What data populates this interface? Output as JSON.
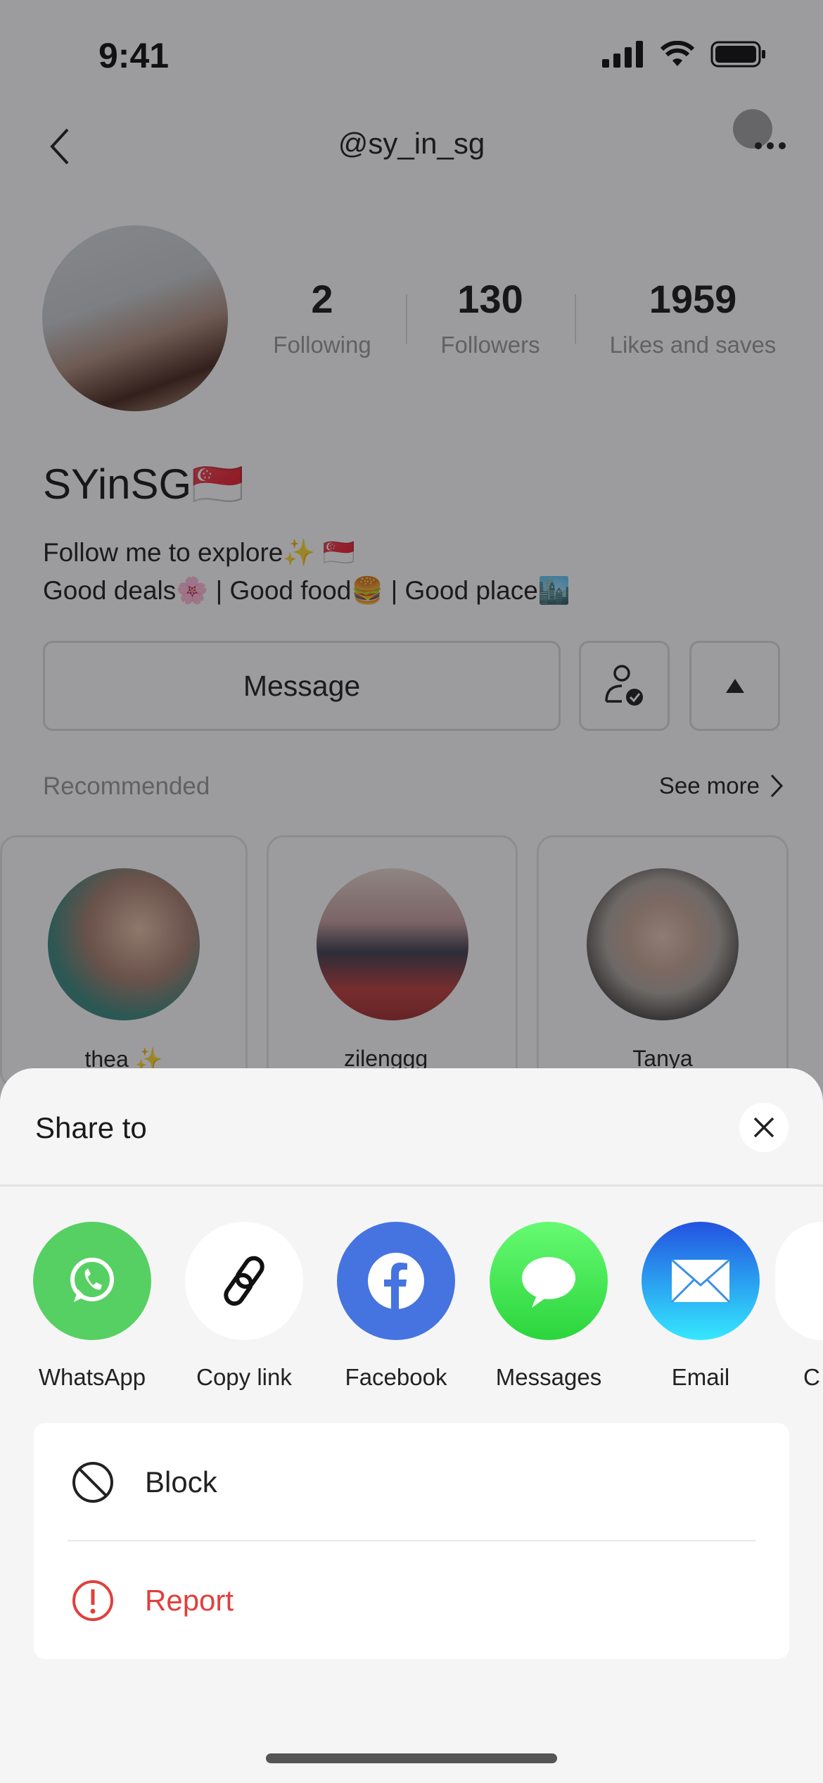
{
  "status_bar": {
    "time": "9:41"
  },
  "header": {
    "handle": "@sy_in_sg"
  },
  "profile": {
    "stats": [
      {
        "value": "2",
        "label": "Following"
      },
      {
        "value": "130",
        "label": "Followers"
      },
      {
        "value": "1959",
        "label": "Likes and saves"
      }
    ],
    "name": "SYinSG🇸🇬",
    "bio": [
      "Follow me to explore✨ 🇸🇬",
      "Good deals🌸 | Good food🍔 | Good place🏙️"
    ],
    "message_label": "Message"
  },
  "recommended": {
    "title": "Recommended",
    "see_more": "See more",
    "users": [
      {
        "name": "thea ✨"
      },
      {
        "name": "zilenggg_"
      },
      {
        "name": "Tanya"
      }
    ]
  },
  "share_sheet": {
    "title": "Share to",
    "targets": [
      {
        "label": "WhatsApp",
        "color": "#56d062"
      },
      {
        "label": "Copy link",
        "color": "#ffffff"
      },
      {
        "label": "Facebook",
        "color": "#4573e0"
      },
      {
        "label": "Messages",
        "color": "#3ee04f"
      },
      {
        "label": "Email",
        "color": "#2a8ef0"
      },
      {
        "label": "C",
        "color": "#ffffff"
      }
    ],
    "actions": [
      {
        "label": "Block",
        "color": "#222222"
      },
      {
        "label": "Report",
        "color": "#e0403c"
      }
    ]
  }
}
